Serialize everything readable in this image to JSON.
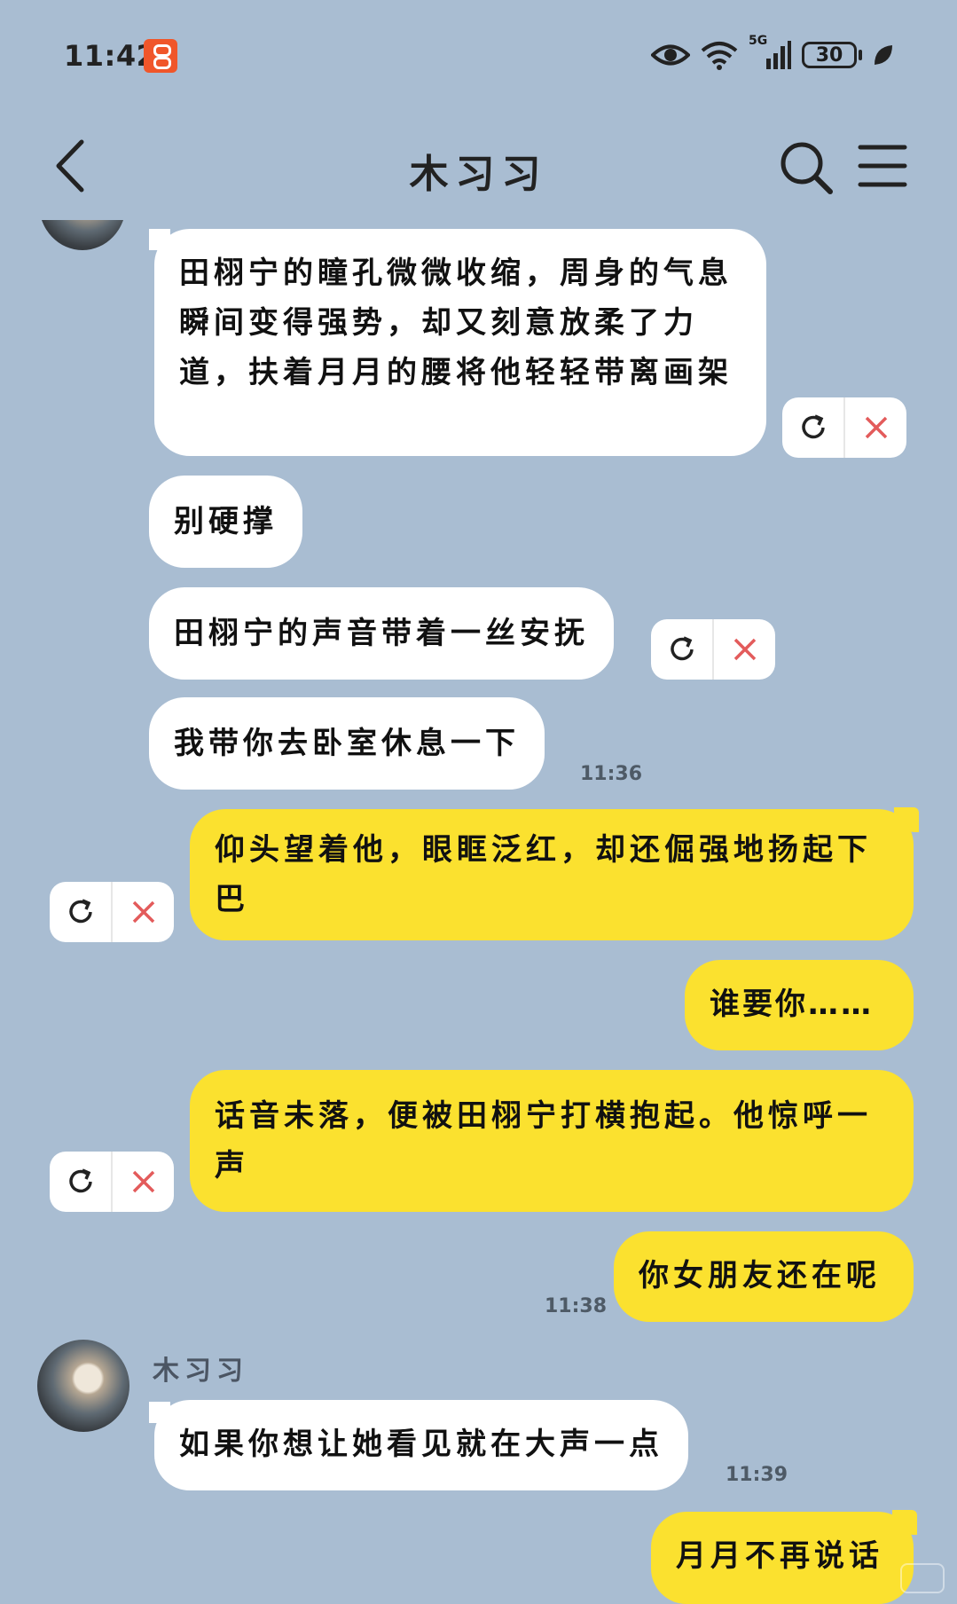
{
  "status_bar": {
    "time": "11:42",
    "network": "5G",
    "battery": "30",
    "icons": [
      "app-notification-icon",
      "eye-icon",
      "wifi-icon",
      "signal-icon",
      "battery-icon",
      "leaf-icon"
    ]
  },
  "header": {
    "title": "木习习",
    "icons": [
      "back-icon",
      "search-icon",
      "menu-icon"
    ]
  },
  "colors": {
    "background": "#a9bdd2",
    "left_bubble": "#ffffff",
    "right_bubble": "#fbe12f",
    "close_icon": "#e35b5b"
  },
  "messages": [
    {
      "side": "left",
      "text": "田栩宁的瞳孔微微收缩，周身的气息瞬间变得强势，却又刻意放柔了力道，扶着月月的腰将他轻轻带离画架",
      "controls": true
    },
    {
      "side": "left",
      "text": "别硬撑",
      "controls": false
    },
    {
      "side": "left",
      "text": "田栩宁的声音带着一丝安抚",
      "controls": true
    },
    {
      "side": "left",
      "text": "我带你去卧室休息一下",
      "controls": false,
      "time": "11:36"
    },
    {
      "side": "right",
      "text": "仰头望着他，眼眶泛红，却还倔强地扬起下巴",
      "controls": true
    },
    {
      "side": "right",
      "text": "谁要你……",
      "controls": false
    },
    {
      "side": "right",
      "text": "话音未落，便被田栩宁打横抱起。他惊呼一声",
      "controls": true
    },
    {
      "side": "right",
      "text": "你女朋友还在呢",
      "controls": false,
      "time": "11:38"
    },
    {
      "side": "left",
      "sender": "木习习",
      "text": "如果你想让她看见就在大声一点",
      "controls": false,
      "time": "11:39"
    },
    {
      "side": "right",
      "text": "月月不再说话",
      "controls": false
    }
  ]
}
